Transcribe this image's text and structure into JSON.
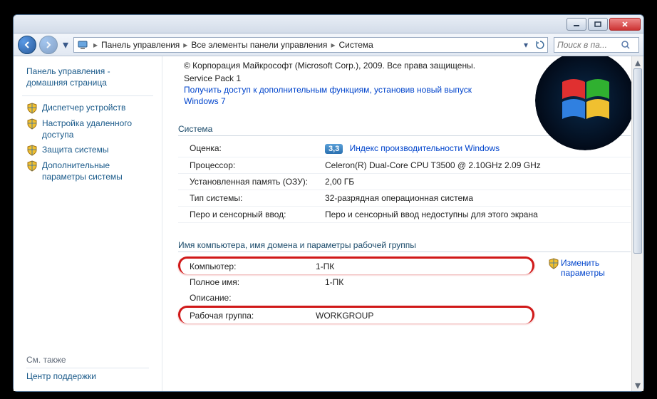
{
  "breadcrumb": {
    "item1": "Панель управления",
    "item2": "Все элементы панели управления",
    "item3": "Система"
  },
  "search": {
    "placeholder": "Поиск в па..."
  },
  "sidebar": {
    "home": "Панель управления - домашняя страница",
    "items": [
      "Диспетчер устройств",
      "Настройка удаленного доступа",
      "Защита системы",
      "Дополнительные параметры системы"
    ],
    "seealso_label": "См. также",
    "seealso_item": "Центр поддержки"
  },
  "main": {
    "copyright": "© Корпорация Майкрософт (Microsoft Corp.), 2009. Все права защищены.",
    "sp": "Service Pack 1",
    "update_link": "Получить доступ к дополнительным функциям, установив новый выпуск Windows 7",
    "section_system": "Система",
    "rows": {
      "rating_label": "Оценка:",
      "rating_value": "3,3",
      "rating_link": "Индекс производительности Windows",
      "cpu_label": "Процессор:",
      "cpu_value": "Celeron(R) Dual-Core CPU       T3500  @ 2.10GHz   2.09 GHz",
      "ram_label": "Установленная память (ОЗУ):",
      "ram_value": "2,00 ГБ",
      "type_label": "Тип системы:",
      "type_value": "32-разрядная операционная система",
      "pen_label": "Перо и сенсорный ввод:",
      "pen_value": "Перо и сенсорный ввод недоступны для этого экрана"
    },
    "section_name": "Имя компьютера, имя домена и параметры рабочей группы",
    "name_rows": {
      "comp_label": "Компьютер:",
      "comp_value": "1-ПК",
      "full_label": "Полное имя:",
      "full_value": "1-ПК",
      "desc_label": "Описание:",
      "wg_label": "Рабочая группа:",
      "wg_value": "WORKGROUP"
    },
    "change_link": "Изменить параметры"
  }
}
